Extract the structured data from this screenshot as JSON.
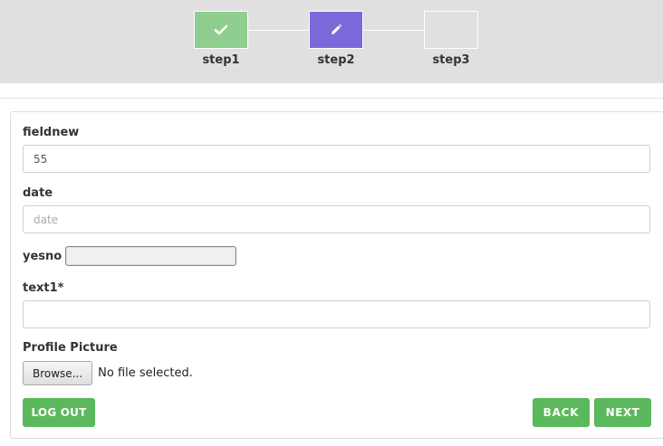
{
  "stepper": {
    "steps": [
      {
        "label": "step1",
        "state": "done",
        "icon": "check-icon"
      },
      {
        "label": "step2",
        "state": "active",
        "icon": "pencil-icon"
      },
      {
        "label": "step3",
        "state": "todo",
        "icon": ""
      }
    ],
    "colors": {
      "done": "#8fce8f",
      "active": "#7b68d9",
      "bar": "#e0e0e0"
    }
  },
  "form": {
    "fieldnew": {
      "label": "fieldnew",
      "value": "55"
    },
    "date": {
      "label": "date",
      "value": "",
      "placeholder": "date"
    },
    "yesno": {
      "label": "yesno",
      "value": ""
    },
    "text1": {
      "label": "text1*",
      "value": ""
    },
    "profile_picture": {
      "label": "Profile Picture",
      "browse_label": "Browse...",
      "status": "No file selected."
    }
  },
  "actions": {
    "logout_label": "LOG OUT",
    "back_label": "BACK",
    "next_label": "NEXT",
    "button_color": "#5cb85c"
  }
}
